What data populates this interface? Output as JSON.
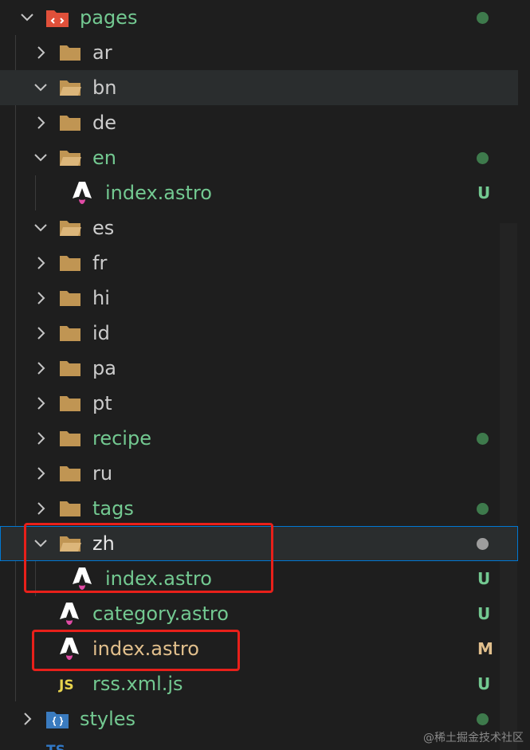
{
  "explorer": {
    "root": {
      "label": "pages",
      "icon": "pages-folder-icon",
      "status": "dot"
    },
    "items": [
      {
        "label": "ar",
        "type": "folder",
        "expanded": false,
        "status": ""
      },
      {
        "label": "bn",
        "type": "folder",
        "expanded": true,
        "status": ""
      },
      {
        "label": "de",
        "type": "folder",
        "expanded": false,
        "status": ""
      },
      {
        "label": "en",
        "type": "folder",
        "expanded": true,
        "status": "dot"
      },
      {
        "label": "index.astro",
        "type": "astro",
        "status": "U"
      },
      {
        "label": "es",
        "type": "folder",
        "expanded": true,
        "status": ""
      },
      {
        "label": "fr",
        "type": "folder",
        "expanded": false,
        "status": ""
      },
      {
        "label": "hi",
        "type": "folder",
        "expanded": false,
        "status": ""
      },
      {
        "label": "id",
        "type": "folder",
        "expanded": false,
        "status": ""
      },
      {
        "label": "pa",
        "type": "folder",
        "expanded": false,
        "status": ""
      },
      {
        "label": "pt",
        "type": "folder",
        "expanded": false,
        "status": ""
      },
      {
        "label": "recipe",
        "type": "folder",
        "expanded": false,
        "status": "dot"
      },
      {
        "label": "ru",
        "type": "folder",
        "expanded": false,
        "status": ""
      },
      {
        "label": "tags",
        "type": "folder",
        "expanded": false,
        "status": "dot"
      },
      {
        "label": "zh",
        "type": "folder",
        "expanded": true,
        "status": "dot"
      },
      {
        "label": "index.astro",
        "type": "astro",
        "status": "U"
      },
      {
        "label": "category.astro",
        "type": "astro",
        "status": "U"
      },
      {
        "label": "index.astro",
        "type": "astro",
        "status": "M"
      },
      {
        "label": "rss.xml.js",
        "type": "js",
        "status": "U"
      }
    ],
    "styles": {
      "label": "styles",
      "status": "dot"
    }
  },
  "colors": {
    "untracked": "#73c991",
    "modified": "#e2c08d",
    "highlight_box": "#e8201a",
    "selection_border": "#0078d4"
  },
  "watermark": "@稀土掘金技术社区"
}
